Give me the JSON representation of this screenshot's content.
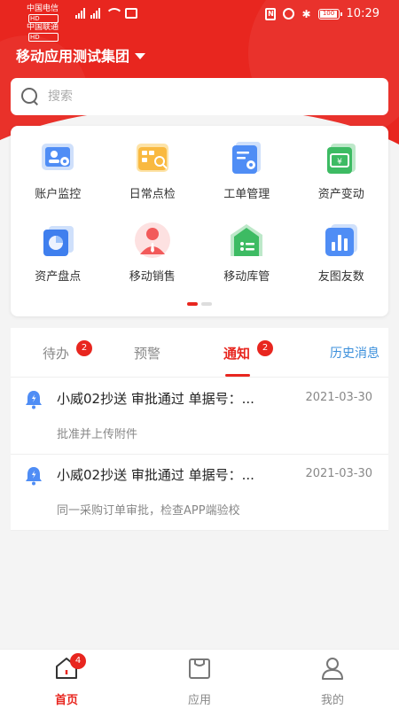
{
  "status_bar": {
    "carrier_1": "中国电信",
    "carrier_2": "中国联通",
    "hd": "HD",
    "battery": "100",
    "time": "10:29"
  },
  "header": {
    "org_name": "移动应用测试集团"
  },
  "search": {
    "placeholder": "搜索"
  },
  "apps": {
    "items": [
      {
        "label": "账户监控",
        "icon": "account-monitor-icon"
      },
      {
        "label": "日常点检",
        "icon": "daily-check-icon"
      },
      {
        "label": "工单管理",
        "icon": "work-order-icon"
      },
      {
        "label": "资产变动",
        "icon": "asset-change-icon"
      },
      {
        "label": "资产盘点",
        "icon": "asset-inventory-icon"
      },
      {
        "label": "移动销售",
        "icon": "mobile-sales-icon"
      },
      {
        "label": "移动库管",
        "icon": "mobile-warehouse-icon"
      },
      {
        "label": "友图友数",
        "icon": "chart-data-icon"
      }
    ],
    "page_count": 2,
    "current_page": 1
  },
  "tabs": {
    "items": [
      {
        "label": "待办",
        "badge": "2"
      },
      {
        "label": "预警",
        "badge": ""
      },
      {
        "label": "通知",
        "badge": "2"
      }
    ],
    "active": "通知",
    "history_label": "历史消息"
  },
  "notices": [
    {
      "title": "小威02抄送  审批通过 单据号：...",
      "date": "2021-03-30",
      "desc": "批准并上传附件"
    },
    {
      "title": "小威02抄送  审批通过 单据号：...",
      "date": "2021-03-30",
      "desc": "同一采购订单审批，检查APP端验校"
    }
  ],
  "bottom_nav": {
    "items": [
      {
        "label": "首页",
        "badge": "4",
        "icon": "home-icon"
      },
      {
        "label": "应用",
        "badge": "",
        "icon": "apps-icon"
      },
      {
        "label": "我的",
        "badge": "",
        "icon": "profile-icon"
      }
    ],
    "active": "首页"
  },
  "colors": {
    "brand": "#e8261f",
    "link": "#3b8fdb"
  }
}
